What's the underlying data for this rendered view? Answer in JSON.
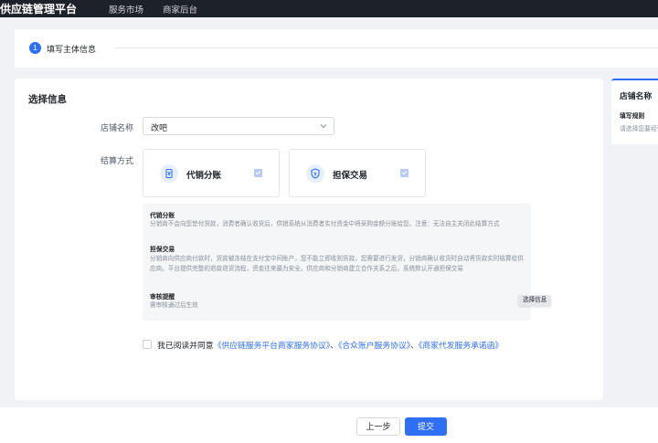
{
  "topbar": {
    "brand": "供应链管理平台",
    "nav": [
      "服务市场",
      "商家后台"
    ]
  },
  "steps": {
    "number": "1",
    "label": "填写主体信息"
  },
  "form": {
    "section_title": "选择信息",
    "store_name_label": "店铺名称",
    "store_name_value": "改吧",
    "settlement_label": "结算方式",
    "options": [
      {
        "label": "代销分账",
        "icon": "coin-icon",
        "checked": true
      },
      {
        "label": "担保交易",
        "icon": "shield-icon",
        "checked": true
      }
    ],
    "info": {
      "title1": "代销分账",
      "text1": "分销商不会向您垫付货款，消费者确认收货后，供销系统从消费者实付资金中将采购金额分账给您。注意：无法自主关闭此结算方式",
      "title2": "担保交易",
      "text2": "分销商向供应商付款时，货款被冻结在支付宝中间账户，您不能立即收到货款，您需要进行发货，分销商确认收货时自动将货款实时结算给供应商。平台提供完整的退款退货流程，资金往来最为安全。供应商和分销商建立合作关系之后，系统默认开通担保交易",
      "title3": "审核提醒",
      "text3": "需审核通过后生效",
      "tooltip": "选择信息"
    },
    "agreement": {
      "prefix": "我已阅读并同意",
      "link1": "《供应链服务平台商家服务协议》",
      "sep1": "、",
      "link2": "《合众账户服务协议》",
      "sep2": "、",
      "link3": "《商家代发服务承诺函》",
      "checked": false
    }
  },
  "side_panel": {
    "title": "店铺名称",
    "rule_label": "填写规则",
    "hint": "请选择您要经营的店铺"
  },
  "footer": {
    "prev_label": "上一步",
    "submit_label": "提交"
  },
  "colors": {
    "primary": "#2f6ff5",
    "topbar_bg": "#1d2129",
    "page_bg": "#f0f2f5"
  }
}
